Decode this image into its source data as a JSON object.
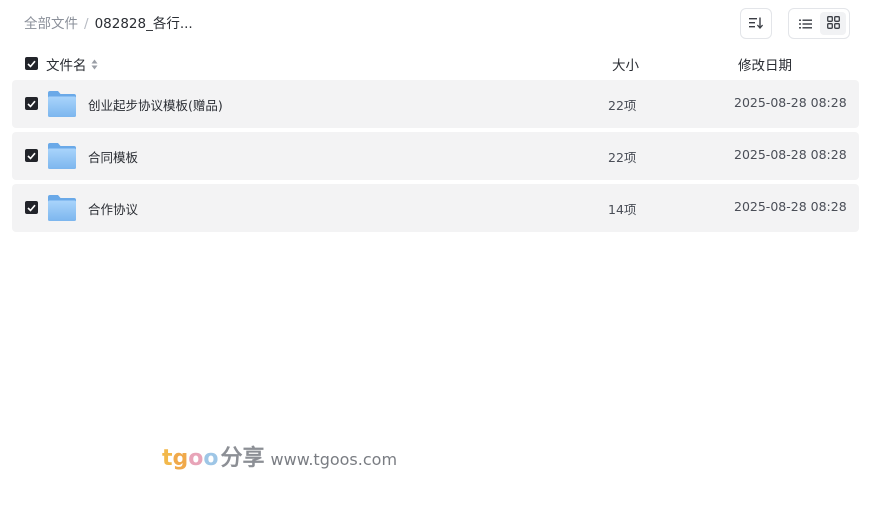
{
  "breadcrumb": {
    "root": "全部文件",
    "separator": "/",
    "current": "082828_各行..."
  },
  "toolbar": {
    "sort_icon": "sort-descending-icon",
    "view_list_icon": "list-view-icon",
    "view_grid_icon": "grid-view-icon"
  },
  "table": {
    "header": {
      "name": "文件名",
      "size": "大小",
      "date": "修改日期"
    },
    "rows": [
      {
        "name": "创业起步协议模板(赠品)",
        "size": "22项",
        "date": "2025-08-28 08:28",
        "checked": true,
        "icon": "folder-icon"
      },
      {
        "name": "合同模板",
        "size": "22项",
        "date": "2025-08-28 08:28",
        "checked": true,
        "icon": "folder-icon"
      },
      {
        "name": "合作协议",
        "size": "14项",
        "date": "2025-08-28 08:28",
        "checked": true,
        "icon": "folder-icon"
      }
    ]
  },
  "watermark": {
    "brand_t": "t",
    "brand_g": "g",
    "brand_o1": "o",
    "brand_o2": "o",
    "brand_cn": "分享",
    "url": "www.tgoos.com"
  },
  "colors": {
    "row_bg": "#f3f3f4",
    "checkbox": "#22242a",
    "folder": "#7fb9f0"
  }
}
